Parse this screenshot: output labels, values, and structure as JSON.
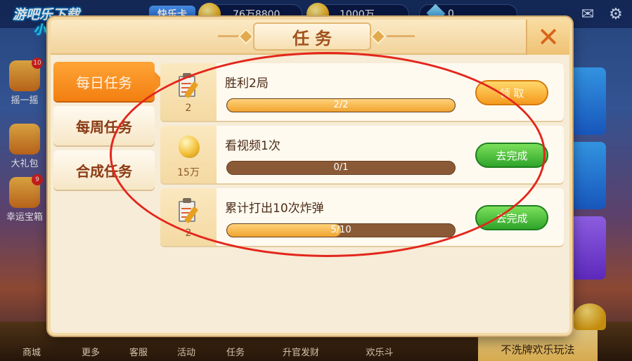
{
  "watermark": {
    "line1": "游吧乐下载",
    "line2": "小编亲测"
  },
  "topbar": {
    "badge_label": "快乐卡",
    "gold_amount": "76万8800",
    "coupon_amount": "1000万",
    "diamond_amount": "0"
  },
  "left_menu": [
    {
      "label": "摇一摇",
      "badge": "10"
    },
    {
      "label": "大礼包"
    },
    {
      "label": "幸运宝箱",
      "badge": "9"
    }
  ],
  "bottom_bar": {
    "items": [
      "商城",
      "更多",
      "客服",
      "活动",
      "任务",
      "升官发财",
      "欢乐斗"
    ],
    "promo_text": "不洗牌欢乐玩法"
  },
  "dialog": {
    "title": "任务",
    "close_label": "✕",
    "tabs": [
      {
        "label": "每日任务",
        "active": true
      },
      {
        "label": "每周任务",
        "active": false
      },
      {
        "label": "合成任务",
        "active": false
      }
    ],
    "tasks": [
      {
        "title": "胜利2局",
        "reward_icon": "clipboard-icon",
        "reward_amount": "2",
        "progress_text": "2/2",
        "progress": 1.0,
        "action_label": "领 取",
        "action_type": "claim"
      },
      {
        "title": "看视频1次",
        "reward_icon": "gold-nugget-icon",
        "reward_amount": "15万",
        "progress_text": "0/1",
        "progress": 0.0,
        "action_label": "去完成",
        "action_type": "go"
      },
      {
        "title": "累计打出10次炸弹",
        "reward_icon": "clipboard-icon",
        "reward_amount": "2",
        "progress_text": "5/10",
        "progress": 0.5,
        "action_label": "去完成",
        "action_type": "go"
      }
    ]
  },
  "colors": {
    "accent_orange": "#f27f10",
    "go_green": "#2fa42a",
    "annotation_red": "#e4261c"
  }
}
